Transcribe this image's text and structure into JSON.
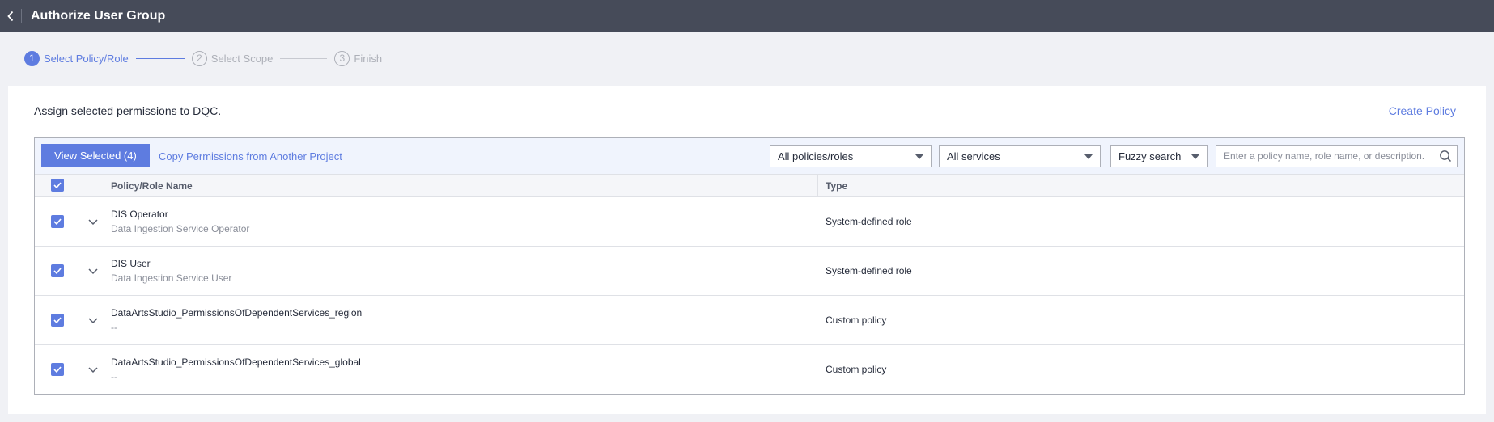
{
  "header": {
    "title": "Authorize User Group"
  },
  "steps": [
    {
      "num": "1",
      "label": "Select Policy/Role"
    },
    {
      "num": "2",
      "label": "Select Scope"
    },
    {
      "num": "3",
      "label": "Finish"
    }
  ],
  "card": {
    "assign_text": "Assign selected permissions to DQC.",
    "create_policy": "Create Policy"
  },
  "toolbar": {
    "view_selected": "View Selected (4)",
    "copy_link": "Copy Permissions from Another Project",
    "policy_filter": "All policies/roles",
    "service_filter": "All services",
    "search_mode": "Fuzzy search",
    "search_placeholder": "Enter a policy name, role name, or description."
  },
  "table": {
    "columns": {
      "name": "Policy/Role Name",
      "type": "Type"
    },
    "rows": [
      {
        "name": "DIS Operator",
        "desc": "Data Ingestion Service Operator",
        "type": "System-defined role",
        "checked": true
      },
      {
        "name": "DIS User",
        "desc": "Data Ingestion Service User",
        "type": "System-defined role",
        "checked": true
      },
      {
        "name": "DataArtsStudio_PermissionsOfDependentServices_region",
        "desc": "--",
        "type": "Custom policy",
        "checked": true
      },
      {
        "name": "DataArtsStudio_PermissionsOfDependentServices_global",
        "desc": "--",
        "type": "Custom policy",
        "checked": true
      }
    ]
  },
  "colors": {
    "accent": "#5e7ce0",
    "topbar": "#464b59",
    "page_bg": "#f0f1f5"
  }
}
